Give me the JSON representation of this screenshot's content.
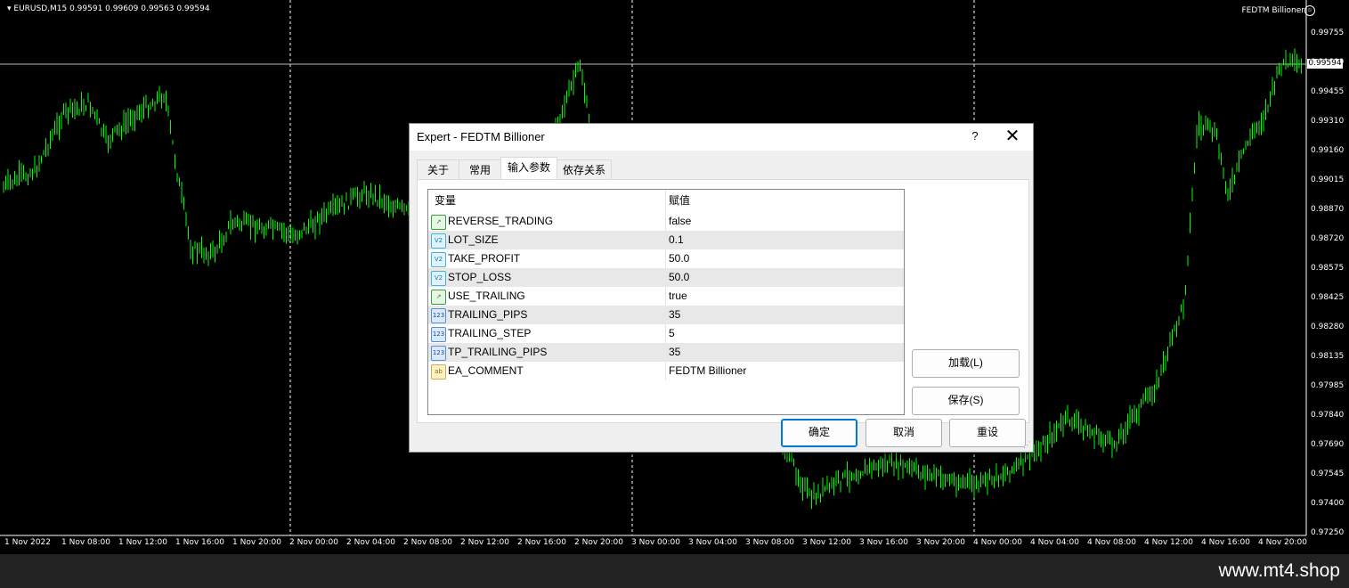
{
  "chart": {
    "symbol_info": "EURUSD,M15  0.99591 0.99609 0.99563 0.99594",
    "ea_name": "FEDTM Billioner",
    "ea_state_icon": "smiley-face-icon",
    "current_price": "0.99594",
    "price_labels": [
      "0.99755",
      "0.99600",
      "0.99455",
      "0.99310",
      "0.99160",
      "0.99015",
      "0.98870",
      "0.98720",
      "0.98575",
      "0.98425",
      "0.98280",
      "0.98135",
      "0.97985",
      "0.97840",
      "0.97690",
      "0.97545",
      "0.97400",
      "0.97250"
    ],
    "time_labels": [
      "1 Nov 2022",
      "1 Nov 08:00",
      "1 Nov 12:00",
      "1 Nov 16:00",
      "1 Nov 20:00",
      "2 Nov 00:00",
      "2 Nov 04:00",
      "2 Nov 08:00",
      "2 Nov 12:00",
      "2 Nov 16:00",
      "2 Nov 20:00",
      "3 Nov 00:00",
      "3 Nov 04:00",
      "3 Nov 08:00",
      "3 Nov 12:00",
      "3 Nov 16:00",
      "3 Nov 20:00",
      "4 Nov 00:00",
      "4 Nov 04:00",
      "4 Nov 08:00",
      "4 Nov 12:00",
      "4 Nov 16:00",
      "4 Nov 20:00"
    ],
    "colors": {
      "background": "#000000",
      "candles": "#00ff00",
      "text": "#ffffff"
    }
  },
  "watermark": "www.mt4.shop",
  "dialog": {
    "title": "Expert - FEDTM Billioner",
    "help": "?",
    "close": "✕",
    "tabs": [
      "关于",
      "常用",
      "输入参数",
      "依存关系"
    ],
    "active_tab": "输入参数",
    "table": {
      "headers": [
        "变量",
        "赋值"
      ],
      "rows": [
        {
          "icon": "bool",
          "name": "REVERSE_TRADING",
          "value": "false"
        },
        {
          "icon": "double",
          "name": "LOT_SIZE",
          "value": "0.1"
        },
        {
          "icon": "double",
          "name": "TAKE_PROFIT",
          "value": "50.0"
        },
        {
          "icon": "double",
          "name": "STOP_LOSS",
          "value": "50.0"
        },
        {
          "icon": "bool",
          "name": "USE_TRAILING",
          "value": "true"
        },
        {
          "icon": "int",
          "name": "TRAILING_PIPS",
          "value": "35"
        },
        {
          "icon": "int",
          "name": "TRAILING_STEP",
          "value": "5"
        },
        {
          "icon": "int",
          "name": "TP_TRAILING_PIPS",
          "value": "35"
        },
        {
          "icon": "string",
          "name": "EA_COMMENT",
          "value": "FEDTM Billioner"
        }
      ]
    },
    "buttons": {
      "load": "加载(L)",
      "save": "保存(S)",
      "ok": "确定",
      "cancel": "取消",
      "reset": "重设"
    }
  }
}
